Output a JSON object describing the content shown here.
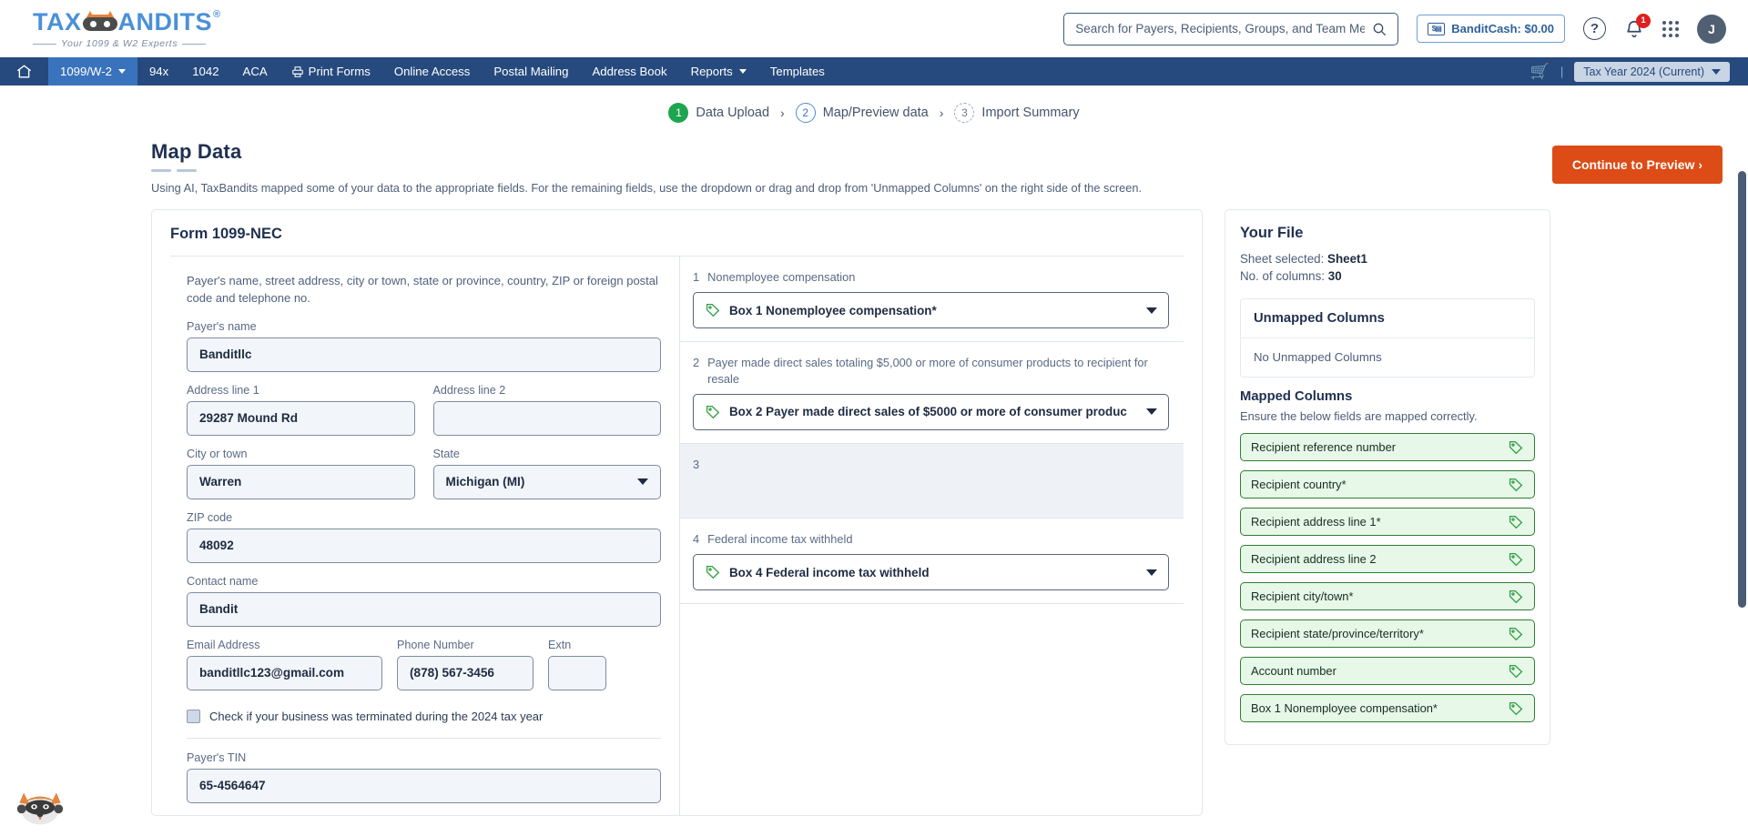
{
  "header": {
    "logo_main": "TAX",
    "logo_main2": "ANDITS",
    "logo_reg": "®",
    "logo_tagline": "Your 1099 & W2 Experts",
    "search_placeholder": "Search for Payers, Recipients, Groups, and Team Members",
    "search_value": "",
    "banditcash_label": "BanditCash: $0.00",
    "notification_count": "1",
    "avatar_initial": "J"
  },
  "nav": {
    "items": [
      {
        "label": "1099/W-2",
        "caret": true,
        "active": true
      },
      {
        "label": "94x",
        "caret": false,
        "active": false
      },
      {
        "label": "1042",
        "caret": false,
        "active": false
      },
      {
        "label": "ACA",
        "caret": false,
        "active": false
      },
      {
        "label": "Print Forms",
        "caret": false,
        "active": false,
        "icon": "printer-icon"
      },
      {
        "label": "Online Access",
        "caret": false,
        "active": false
      },
      {
        "label": "Postal Mailing",
        "caret": false,
        "active": false
      },
      {
        "label": "Address Book",
        "caret": false,
        "active": false
      },
      {
        "label": "Reports",
        "caret": true,
        "active": false
      },
      {
        "label": "Templates",
        "caret": false,
        "active": false
      }
    ],
    "tax_year": "Tax Year 2024 (Current)",
    "divider": "|"
  },
  "stepper": {
    "steps": [
      {
        "num": "1",
        "label": "Data Upload",
        "state": "done"
      },
      {
        "num": "2",
        "label": "Map/Preview data",
        "state": "active"
      },
      {
        "num": "3",
        "label": "Import Summary",
        "state": "todo"
      }
    ],
    "separator": "›"
  },
  "page": {
    "title": "Map Data",
    "subtitle": "Using AI, TaxBandits mapped some of your data to the appropriate fields. For the remaining fields, use the dropdown or drag and drop from 'Unmapped Columns' on the right side of the screen.",
    "primary_button": "Continue to Preview  ›"
  },
  "form": {
    "title": "Form 1099-NEC",
    "payer_note": "Payer's name, street address, city or town, state or province, country, ZIP or foreign postal code and telephone no.",
    "fields": {
      "payer_name_label": "Payer's name",
      "payer_name_value": "Banditllc",
      "address1_label": "Address line 1",
      "address1_value": "29287 Mound Rd",
      "address2_label": "Address line 2",
      "address2_value": "",
      "city_label": "City or town",
      "city_value": "Warren",
      "state_label": "State",
      "state_value": "Michigan (MI)",
      "zip_label": "ZIP code",
      "zip_value": "48092",
      "contact_label": "Contact name",
      "contact_value": "Bandit",
      "email_label": "Email Address",
      "email_value": "banditllc123@gmail.com",
      "phone_label": "Phone Number",
      "phone_value": "(878) 567-3456",
      "extn_label": "Extn",
      "extn_value": "",
      "terminated_checkbox_label": "Check if your business was terminated during the 2024 tax year",
      "tin_label": "Payer's TIN",
      "tin_value": "65-4564647"
    }
  },
  "boxes": [
    {
      "num": "1",
      "label": "Nonemployee compensation",
      "selected": "Box 1 Nonemployee compensation*",
      "mapped": true,
      "shaded": false
    },
    {
      "num": "2",
      "label": "Payer made direct sales totaling $5,000 or more of consumer products to recipient for resale",
      "selected": "Box 2 Payer made direct sales of $5000 or more of consumer produc",
      "mapped": true,
      "shaded": false
    },
    {
      "num": "3",
      "label": "",
      "selected": "",
      "mapped": false,
      "shaded": true
    },
    {
      "num": "4",
      "label": "Federal income tax withheld",
      "selected": "Box 4 Federal income tax withheld",
      "mapped": true,
      "shaded": false
    }
  ],
  "right_panel": {
    "title": "Your File",
    "sheet_label": "Sheet selected:",
    "sheet_value": "Sheet1",
    "columns_label": "No. of columns:",
    "columns_value": "30",
    "unmapped_header": "Unmapped Columns",
    "unmapped_empty": "No Unmapped Columns",
    "mapped_header": "Mapped Columns",
    "mapped_note": "Ensure the below fields are mapped correctly.",
    "mapped_items": [
      "Recipient reference number",
      "Recipient country*",
      "Recipient address line 1*",
      "Recipient address line 2",
      "Recipient city/town*",
      "Recipient state/province/territory*",
      "Account number",
      "Box 1 Nonemployee compensation*"
    ]
  }
}
